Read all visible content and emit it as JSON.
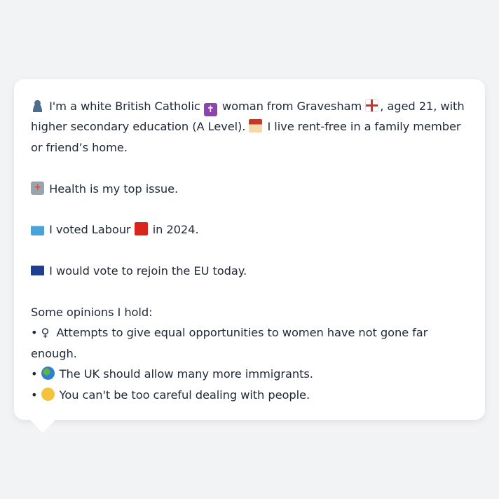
{
  "intro": {
    "part1": "I'm a white British Catholic",
    "part2": "woman from Gravesham",
    "part3": ", aged 21, with higher secondary education (A Level).",
    "part4": "I live rent-free in a family member or friend’s home."
  },
  "issue": "Health is my top issue.",
  "vote": {
    "part1": "I voted Labour",
    "part2": "in 2024."
  },
  "eu": "I would vote to rejoin the EU today.",
  "opinions": {
    "heading": "Some opinions I hold:",
    "bullet": "•",
    "female_symbol": "♀",
    "items": [
      "Attempts to give equal opportunities to women have not gone far enough.",
      "The UK should allow many more immigrants.",
      "You can't be too careful dealing with people."
    ]
  },
  "colors": {
    "background": "#f2f3f5",
    "card": "#ffffff",
    "text": "#1f2937",
    "labour_red": "#d9261c"
  }
}
